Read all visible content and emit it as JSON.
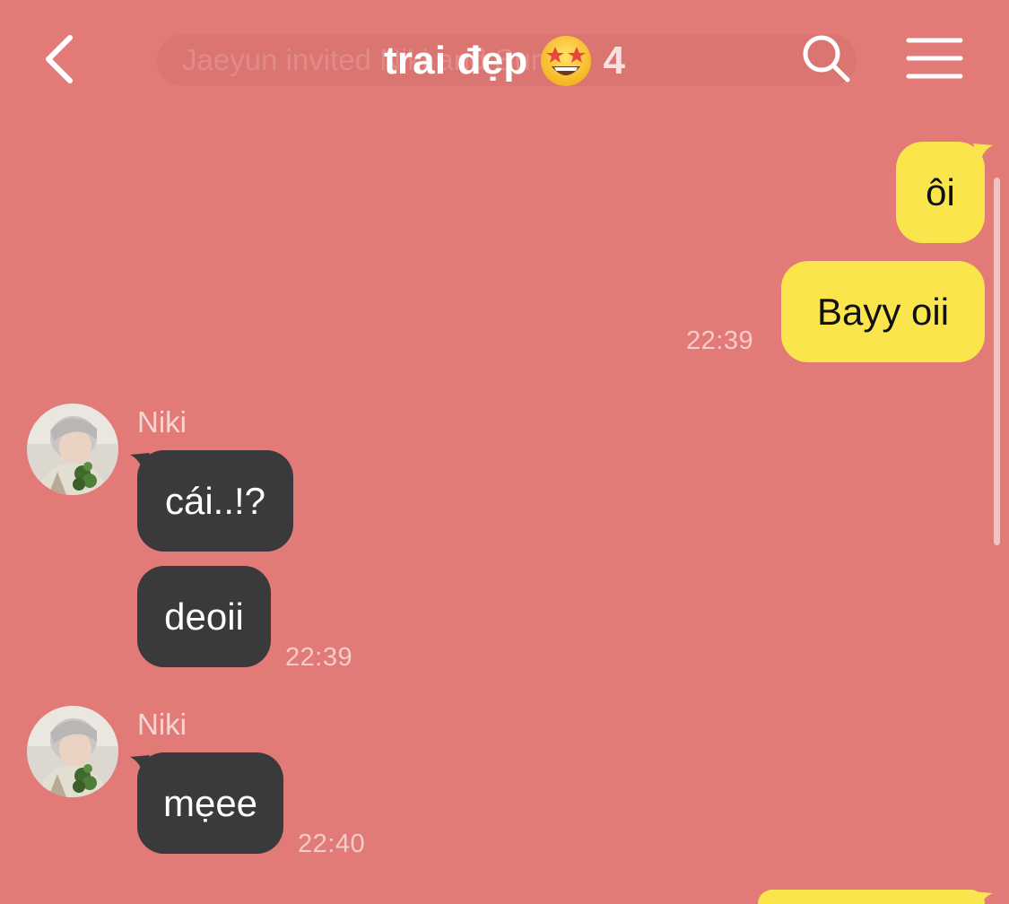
{
  "header": {
    "background_notice": "Jaeyun invited Niki and Sunoo",
    "title": "trai đẹp",
    "title_emoji": "star-struck-emoji",
    "member_count": "4",
    "back_icon": "chevron-left-icon",
    "search_icon": "search-icon",
    "menu_icon": "menu-icon"
  },
  "colors": {
    "background": "#E27A77",
    "my_bubble": "#FBE54D",
    "their_bubble": "#3A393C"
  },
  "messages": {
    "m1": {
      "text": "ôi"
    },
    "m2": {
      "text": "Bayy oii",
      "time": "22:39"
    },
    "g1": {
      "sender": "Niki",
      "m3": {
        "text": "cái..!?"
      },
      "m4": {
        "text": "deoii",
        "time": "22:39"
      }
    },
    "g2": {
      "sender": "Niki",
      "m5": {
        "text": "mẹee",
        "time": "22:40"
      }
    }
  }
}
